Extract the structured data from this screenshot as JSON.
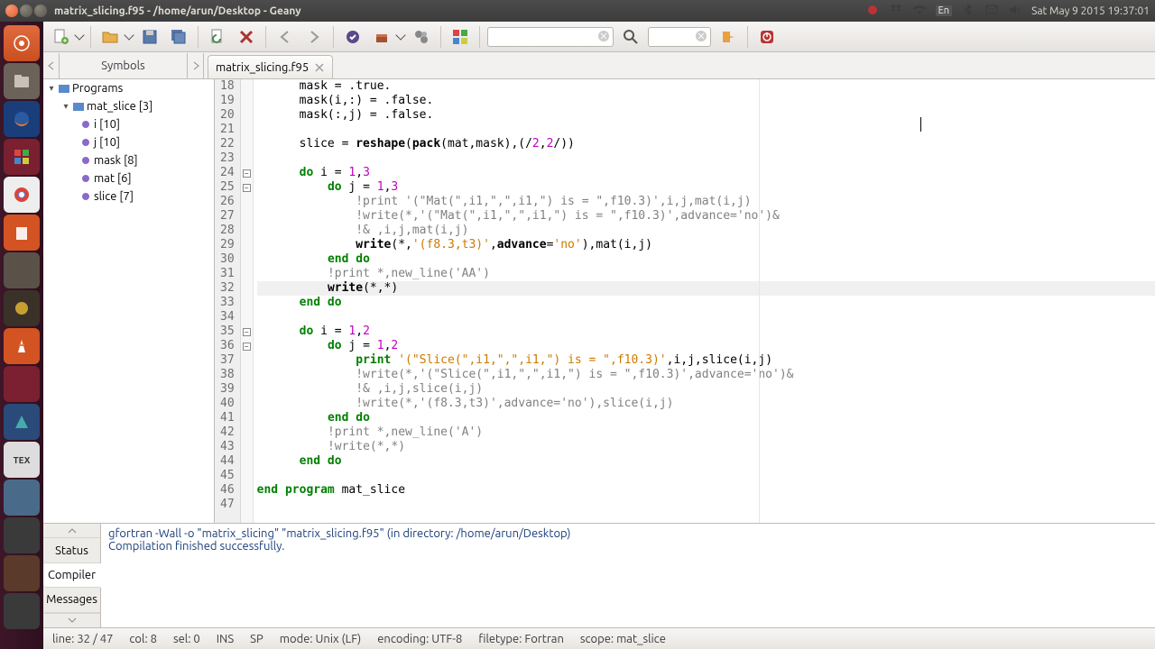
{
  "window": {
    "title": "matrix_slicing.f95 - /home/arun/Desktop - Geany"
  },
  "panel": {
    "lang": "En",
    "clock": "Sat May  9 2015 19:37:01"
  },
  "toolbar": {
    "search_value": "",
    "search_placeholder": "",
    "goto_value": "",
    "goto_placeholder": ""
  },
  "symbols_header": "Symbols",
  "tab": {
    "name": "matrix_slicing.f95"
  },
  "tree": {
    "root": "Programs",
    "program": "mat_slice [3]",
    "vars": [
      "i [10]",
      "j [10]",
      "mask [8]",
      "mat [6]",
      "slice [7]"
    ]
  },
  "lines": [
    {
      "n": 18,
      "fold": "",
      "html": "      mask = .true."
    },
    {
      "n": 19,
      "fold": "",
      "html": "      mask(i,:) = .false."
    },
    {
      "n": 20,
      "fold": "",
      "html": "      mask(:,j) = .false."
    },
    {
      "n": 21,
      "fold": "",
      "html": ""
    },
    {
      "n": 22,
      "fold": "",
      "html": "      slice = <span class='fn'>reshape</span>(<span class='fn'>pack</span>(mat,mask),(/<span class='num'>2</span>,<span class='num'>2</span>/))"
    },
    {
      "n": 23,
      "fold": "",
      "html": ""
    },
    {
      "n": 24,
      "fold": "-",
      "html": "      <span class='k'>do</span> i = <span class='num'>1</span>,<span class='num'>3</span>"
    },
    {
      "n": 25,
      "fold": "-",
      "html": "          <span class='k'>do</span> j = <span class='num'>1</span>,<span class='num'>3</span>"
    },
    {
      "n": 26,
      "fold": "",
      "html": "              <span class='cmt'>!print '(\"Mat(\",i1,\",\",i1,\") is = \",f10.3)',i,j,mat(i,j)</span>"
    },
    {
      "n": 27,
      "fold": "",
      "html": "              <span class='cmt'>!write(*,'(\"Mat(\",i1,\",\",i1,\") is = \",f10.3)',advance='no')&</span>"
    },
    {
      "n": 28,
      "fold": "",
      "html": "              <span class='cmt'>!& ,i,j,mat(i,j)</span>"
    },
    {
      "n": 29,
      "fold": "",
      "html": "              <span class='fn'>write</span>(*,<span class='str'>'(f8.3,t3)'</span>,<span class='fn'>advance</span>=<span class='str'>'no'</span>),mat(i,j)"
    },
    {
      "n": 30,
      "fold": "",
      "html": "          <span class='k'>end do</span>"
    },
    {
      "n": 31,
      "fold": "",
      "html": "          <span class='cmt'>!print *,new_line('AA')</span>"
    },
    {
      "n": 32,
      "fold": "",
      "html": "          <span class='fn'>write</span>(*,*)",
      "hl": true
    },
    {
      "n": 33,
      "fold": "",
      "html": "      <span class='k'>end do</span>"
    },
    {
      "n": 34,
      "fold": "",
      "html": ""
    },
    {
      "n": 35,
      "fold": "-",
      "html": "      <span class='k'>do</span> i = <span class='num'>1</span>,<span class='num'>2</span>"
    },
    {
      "n": 36,
      "fold": "-",
      "html": "          <span class='k'>do</span> j = <span class='num'>1</span>,<span class='num'>2</span>"
    },
    {
      "n": 37,
      "fold": "",
      "html": "              <span class='k'>print</span> <span class='str'>'(\"Slice(\",i1,\",\",i1,\") is = \",f10.3)'</span>,i,j,slice(i,j)"
    },
    {
      "n": 38,
      "fold": "",
      "html": "              <span class='cmt'>!write(*,'(\"Slice(\",i1,\",\",i1,\") is = \",f10.3)',advance='no')&</span>"
    },
    {
      "n": 39,
      "fold": "",
      "html": "              <span class='cmt'>!& ,i,j,slice(i,j)</span>"
    },
    {
      "n": 40,
      "fold": "",
      "html": "              <span class='cmt'>!write(*,'(f8.3,t3)',advance='no'),slice(i,j)</span>"
    },
    {
      "n": 41,
      "fold": "",
      "html": "          <span class='k'>end do</span>"
    },
    {
      "n": 42,
      "fold": "",
      "html": "          <span class='cmt'>!print *,new_line('A')</span>"
    },
    {
      "n": 43,
      "fold": "",
      "html": "          <span class='cmt'>!write(*,*)</span>"
    },
    {
      "n": 44,
      "fold": "",
      "html": "      <span class='k'>end do</span>"
    },
    {
      "n": 45,
      "fold": "",
      "html": ""
    },
    {
      "n": 46,
      "fold": "",
      "html": "<span class='k'>end program</span> mat_slice"
    },
    {
      "n": 47,
      "fold": "",
      "html": ""
    }
  ],
  "compiler": {
    "line1": "gfortran -Wall -o \"matrix_slicing\" \"matrix_slicing.f95\" (in directory: /home/arun/Desktop)",
    "line2": "Compilation finished successfully."
  },
  "msg_tabs": {
    "status": "Status",
    "compiler": "Compiler",
    "messages": "Messages"
  },
  "statusbar": {
    "line": "line: 32 / 47",
    "col": "col: 8",
    "sel": "sel: 0",
    "ins": "INS",
    "sp": "SP",
    "mode": "mode: Unix (LF)",
    "enc": "encoding: UTF-8",
    "ft": "filetype: Fortran",
    "scope": "scope: mat_slice"
  }
}
